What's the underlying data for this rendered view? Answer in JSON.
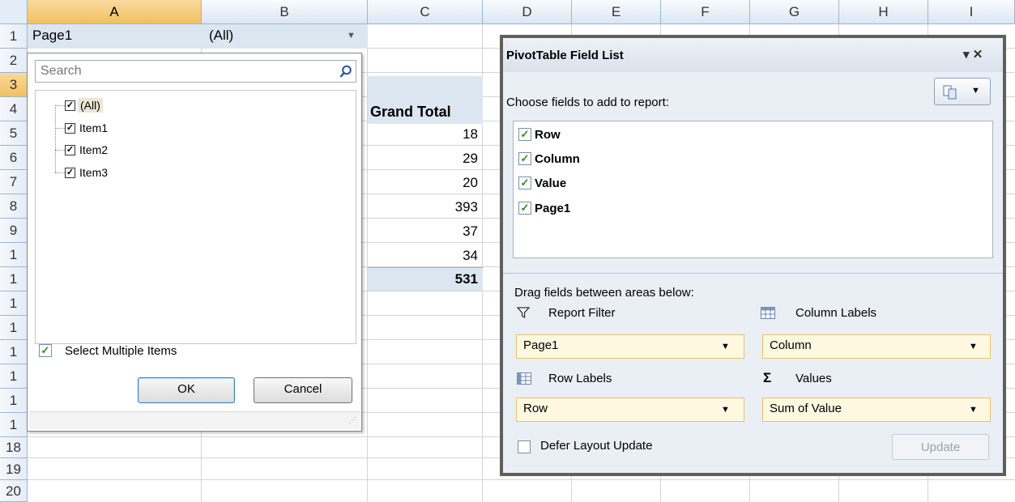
{
  "sheet": {
    "columns": [
      "A",
      "B",
      "C",
      "D",
      "E",
      "F",
      "G",
      "H",
      "I"
    ],
    "rows": [
      "1",
      "2",
      "3",
      "4",
      "5",
      "6",
      "7",
      "8",
      "9",
      "1",
      "1",
      "1",
      "1",
      "1",
      "1",
      "1",
      "1",
      "18",
      "19",
      "20"
    ],
    "a1": "Page1",
    "b1": "(All)",
    "grand_total_header": "Grand Total",
    "grand_total_values": [
      "18",
      "29",
      "20",
      "393",
      "37",
      "34"
    ],
    "grand_total_sum": "531"
  },
  "filter_dropdown": {
    "search_placeholder": "Search",
    "items": [
      {
        "label": "(All)",
        "checked": true
      },
      {
        "label": "Item1",
        "checked": true
      },
      {
        "label": "Item2",
        "checked": true
      },
      {
        "label": "Item3",
        "checked": true
      }
    ],
    "select_multiple_label": "Select Multiple Items",
    "ok_label": "OK",
    "cancel_label": "Cancel"
  },
  "pivot_panel": {
    "title": "PivotTable Field List",
    "title_controls": "▾ ✕",
    "choose_fields_label": "Choose fields to add to report:",
    "fields": [
      {
        "label": "Row",
        "checked": true
      },
      {
        "label": "Column",
        "checked": true
      },
      {
        "label": "Value",
        "checked": true
      },
      {
        "label": "Page1",
        "checked": true
      }
    ],
    "drag_label": "Drag fields between areas below:",
    "report_filter_label": "Report Filter",
    "column_labels_label": "Column Labels",
    "row_labels_label": "Row Labels",
    "values_label": "Values",
    "report_filter_value": "Page1",
    "column_labels_value": "Column",
    "row_labels_value": "Row",
    "values_value": "Sum of Value",
    "defer_label": "Defer Layout Update",
    "update_label": "Update"
  }
}
